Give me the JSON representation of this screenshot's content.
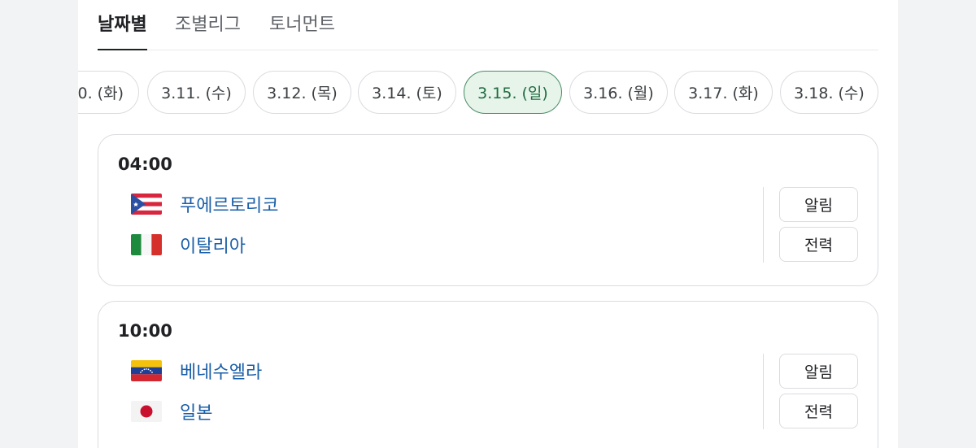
{
  "tabs": [
    {
      "label": "날짜별",
      "active": true
    },
    {
      "label": "조별리그",
      "active": false
    },
    {
      "label": "토너먼트",
      "active": false
    }
  ],
  "dates": [
    {
      "label": "0. (화)"
    },
    {
      "label": "3.11. (수)"
    },
    {
      "label": "3.12. (목)"
    },
    {
      "label": "3.14. (토)"
    },
    {
      "label": "3.15. (일)",
      "selected": true
    },
    {
      "label": "3.16. (월)"
    },
    {
      "label": "3.17. (화)"
    },
    {
      "label": "3.18. (수)"
    }
  ],
  "matches": [
    {
      "time": "04:00",
      "team_a": {
        "name": "푸에르토리코",
        "flag_icon": "flag-puerto-rico"
      },
      "team_b": {
        "name": "이탈리아",
        "flag_icon": "flag-italy"
      },
      "alarm_label": "알림",
      "record_label": "전력"
    },
    {
      "time": "10:00",
      "team_a": {
        "name": "베네수엘라",
        "flag_icon": "flag-venezuela"
      },
      "team_b": {
        "name": "일본",
        "flag_icon": "flag-japan"
      },
      "alarm_label": "알림",
      "record_label": "전력"
    }
  ],
  "colors": {
    "selected_chip_bg": "#e6f4ea",
    "selected_chip_border": "#4a8c65",
    "team_link": "#1a5fa8"
  }
}
